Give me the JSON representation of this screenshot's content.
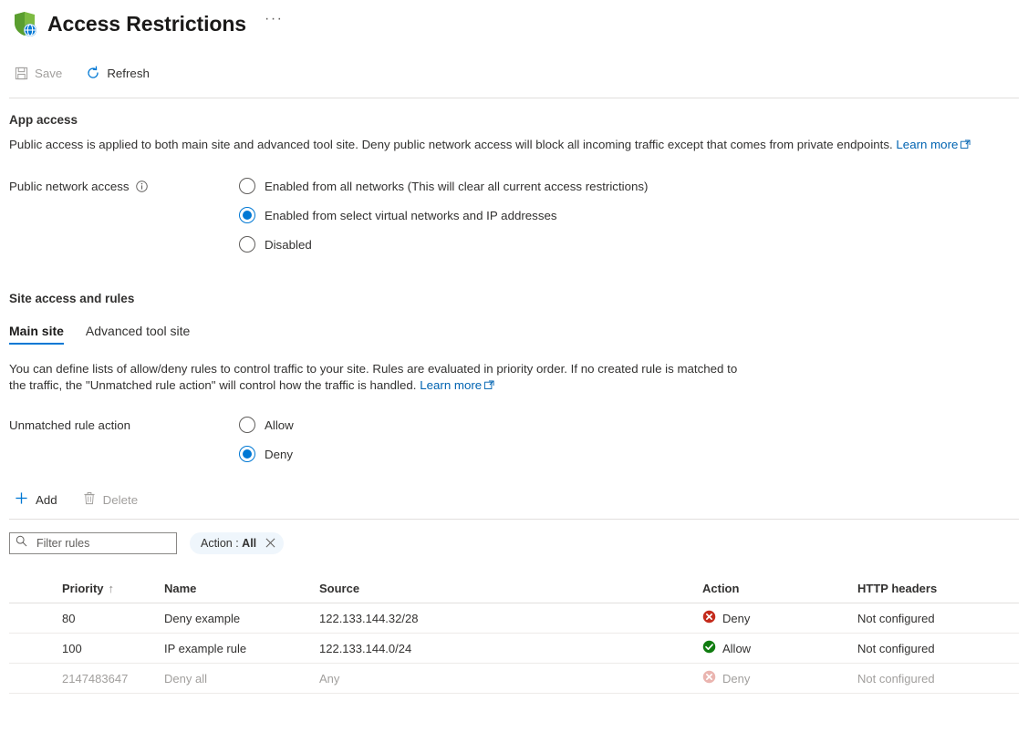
{
  "blade": {
    "title": "Access Restrictions",
    "icon": "shield-globe-icon",
    "more_menu_label": "···"
  },
  "commandbar": {
    "save": {
      "label": "Save",
      "icon": "save-icon",
      "enabled": false
    },
    "refresh": {
      "label": "Refresh",
      "icon": "refresh-icon",
      "enabled": true
    }
  },
  "app_access": {
    "heading": "App access",
    "description": "Public access is applied to both main site and advanced tool site. Deny public network access will block all incoming traffic except that comes from private endpoints.",
    "learn_more": "Learn more",
    "field_label": "Public network access",
    "options": [
      {
        "label": "Enabled from all networks (This will clear all current access restrictions)",
        "checked": false
      },
      {
        "label": "Enabled from select virtual networks and IP addresses",
        "checked": true
      },
      {
        "label": "Disabled",
        "checked": false
      }
    ]
  },
  "site_access": {
    "heading": "Site access and rules",
    "tabs": [
      {
        "label": "Main site",
        "active": true
      },
      {
        "label": "Advanced tool site",
        "active": false
      }
    ],
    "description_line1": "You can define lists of allow/deny rules to control traffic to your site. Rules are evaluated in priority order. If no created rule is matched to",
    "description_line2": "the traffic, the \"Unmatched rule action\" will control how the traffic is handled.",
    "learn_more": "Learn more",
    "unmatched_label": "Unmatched rule action",
    "unmatched_options": [
      {
        "label": "Allow",
        "checked": false
      },
      {
        "label": "Deny",
        "checked": true
      }
    ]
  },
  "table_toolbar": {
    "add": {
      "label": "Add",
      "icon": "plus-icon",
      "enabled": true
    },
    "delete": {
      "label": "Delete",
      "icon": "trash-icon",
      "enabled": false
    }
  },
  "filters": {
    "search_placeholder": "Filter rules",
    "search_value": "",
    "search_icon": "search-icon",
    "pill": {
      "prefix": "Action :",
      "value": "All",
      "dismiss_icon": "close-icon"
    }
  },
  "rules_grid": {
    "columns": [
      {
        "key": "priority",
        "label": "Priority",
        "sorted": true,
        "sort_arrow": "↑"
      },
      {
        "key": "name",
        "label": "Name"
      },
      {
        "key": "source",
        "label": "Source"
      },
      {
        "key": "action",
        "label": "Action"
      },
      {
        "key": "headers",
        "label": "HTTP headers"
      }
    ],
    "rows": [
      {
        "priority": "80",
        "name": "Deny example",
        "source": "122.133.144.32/28",
        "action": "Deny",
        "action_icon": "deny-icon",
        "headers": "Not configured",
        "dimmed": false
      },
      {
        "priority": "100",
        "name": "IP example rule",
        "source": "122.133.144.0/24",
        "action": "Allow",
        "action_icon": "allow-icon",
        "headers": "Not configured",
        "dimmed": false
      },
      {
        "priority": "2147483647",
        "name": "Deny all",
        "source": "Any",
        "action": "Deny",
        "action_icon": "deny-icon",
        "headers": "Not configured",
        "dimmed": true
      }
    ]
  },
  "colors": {
    "accent": "#0078d4",
    "link": "#0063b1",
    "deny_red": "#c42b1c",
    "allow_green": "#107c10",
    "shield_green": "#5cb335",
    "disabled_text": "#a19f9d",
    "pill_bg": "#eff6fc"
  }
}
